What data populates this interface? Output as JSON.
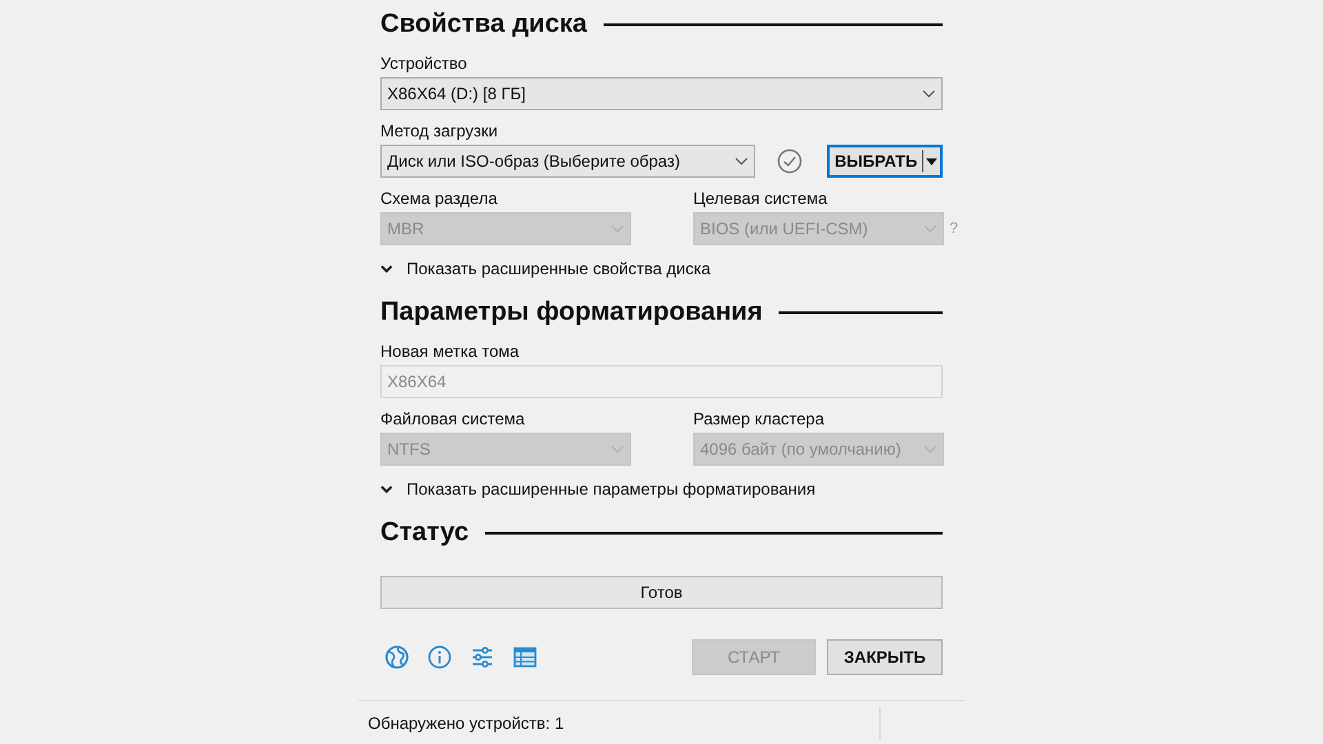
{
  "sections": [
    {
      "title": "Свойства диска",
      "rows": [
        {
          "kind": "select",
          "label": "Устройство",
          "value": "X86X64 (D:) [8 ГБ]",
          "disabled": false
        },
        {
          "kind": "boot",
          "label": "Метод загрузки",
          "value": "Диск или ISO-образ (Выберите образ)",
          "disabled": false,
          "button": "ВЫБРАТЬ"
        },
        {
          "kind": "pair",
          "items": [
            {
              "label": "Схема раздела",
              "value": "MBR",
              "disabled": true
            },
            {
              "label": "Целевая система",
              "value": "BIOS (или UEFI-CSM)",
              "disabled": true
            }
          ],
          "help": "?"
        },
        {
          "kind": "expander",
          "label": "Показать расширенные свойства диска",
          "expanded": false
        }
      ]
    },
    {
      "title": "Параметры форматирования",
      "rows": [
        {
          "kind": "input",
          "label": "Новая метка тома",
          "value": "X86X64",
          "disabled": true
        },
        {
          "kind": "pair",
          "items": [
            {
              "label": "Файловая система",
              "value": "NTFS",
              "disabled": true
            },
            {
              "label": "Размер кластера",
              "value": "4096 байт (по умолчанию)",
              "disabled": true
            }
          ]
        },
        {
          "kind": "expander",
          "label": "Показать расширенные параметры форматирования",
          "expanded": false
        }
      ]
    },
    {
      "title": "Статус",
      "rows": [
        {
          "kind": "progress",
          "label": "Готов"
        }
      ]
    }
  ],
  "buttons": [
    {
      "label": "СТАРТ",
      "disabled": true
    },
    {
      "label": "ЗАКРЫТЬ",
      "disabled": false
    }
  ],
  "status_bar": {
    "text": "Обнаружено устройств: 1"
  }
}
